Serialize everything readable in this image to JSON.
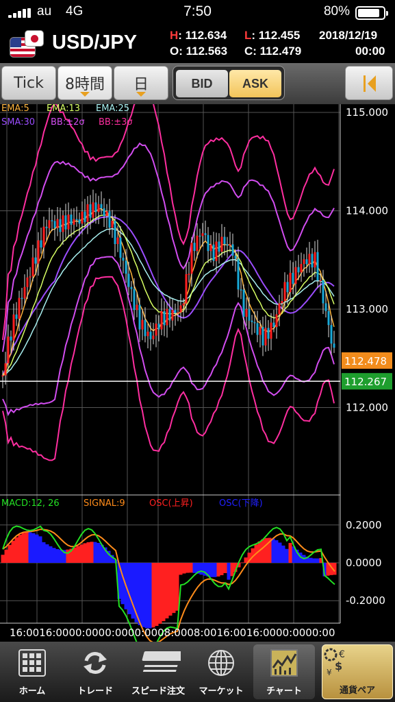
{
  "status_bar": {
    "carrier": "au",
    "network": "4G",
    "time": "7:50",
    "battery": "80%"
  },
  "header": {
    "pair": "USD/JPY",
    "high_label": "H",
    "high": ": 112.634",
    "low_label": "L",
    "low": ": 112.455",
    "date": "2018/12/19",
    "open_label": "O",
    "open": ": 112.563",
    "close_label": "C",
    "close": ": 112.479",
    "time": "00:00"
  },
  "tabs": {
    "tick": "Tick",
    "hours": "8時間",
    "day": "日",
    "bid": "BID",
    "ask": "ASK"
  },
  "price_chart": {
    "y_ticks": [
      "115.000",
      "114.000",
      "113.000",
      "112.000"
    ],
    "current_ask": "112.478",
    "current_line": "112.267",
    "legend": [
      {
        "text": "EMA:5",
        "color": "#ffb43c"
      },
      {
        "text": "EMA:13",
        "color": "#d8ff64"
      },
      {
        "text": "EMA:25",
        "color": "#a8f0f0"
      },
      {
        "text": "SMA:30",
        "color": "#9b4dff"
      },
      {
        "text": "BB:±2σ",
        "color": "#d24df0"
      },
      {
        "text": "BB:±3σ",
        "color": "#ff2ea0"
      }
    ]
  },
  "macd_chart": {
    "legend": [
      {
        "text": "MACD:12, 26",
        "color": "#23e023"
      },
      {
        "text": "SIGNAL:9",
        "color": "#ff8c1a"
      },
      {
        "text": "OSC(上昇)",
        "color": "#ff2020"
      },
      {
        "text": "OSC(下降)",
        "color": "#2020ff"
      }
    ],
    "y_ticks": [
      "0.2000",
      "0.0000",
      "-0.2000"
    ]
  },
  "x_axis": {
    "labels": "16:0016:0000:0000:0000:0008:0008:0016:0016:0000:0000:00"
  },
  "colors": {
    "bull": "#ff2020",
    "bear": "#19a9d8",
    "ask_badge": "#f28c1c",
    "line_badge": "#1e9e2e"
  },
  "bottom_nav": [
    {
      "label": "ホーム",
      "icon": "grid-icon"
    },
    {
      "label": "トレード",
      "icon": "refresh-icon"
    },
    {
      "label": "スピード注文",
      "icon": "speed-icon"
    },
    {
      "label": "マーケット",
      "icon": "globe-icon"
    },
    {
      "label": "チャート",
      "icon": "chart-icon"
    },
    {
      "label": "通貨ペア",
      "icon": "currency-icon"
    }
  ]
}
